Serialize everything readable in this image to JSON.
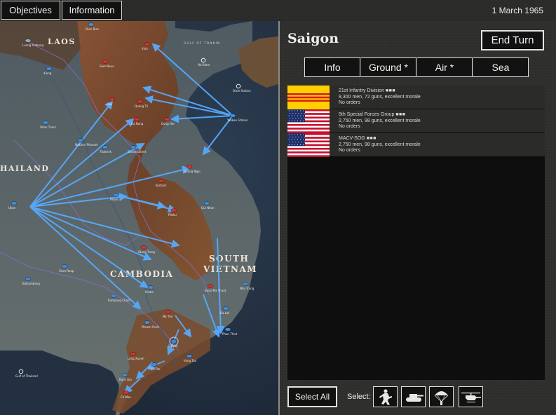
{
  "topbar": {
    "objectives_label": "Objectives",
    "information_label": "Information",
    "date": "1 March 1965"
  },
  "map": {
    "country_labels": {
      "laos": "LAOS",
      "thailand": "HAILAND",
      "cambodia": "CAMBODIA",
      "south_vietnam_1": "SOUTH",
      "south_vietnam_2": "VIETNAM"
    },
    "sea_label": "GULF OF TONKIN",
    "towns": [
      "Dien Bien",
      "Luang Prabang",
      "Xieng",
      "Sam Neua",
      "Vinh",
      "Dong Hoi",
      "Quang Tri",
      "Hue",
      "Da Nang",
      "Quang Ngai",
      "Kontum",
      "Pleiku",
      "Qui Nhon",
      "Buon Ma Thuot",
      "Nha Trang",
      "Da Lat",
      "Phan Thiet",
      "Vung Tau",
      "Saigon",
      "My Tho",
      "Can Tho",
      "Ca Mau",
      "Rach Gia",
      "Long Xuyen",
      "Phnom Penh",
      "Kampong Cham",
      "Kratie",
      "Stung Treng",
      "Siem Reap",
      "Battambang",
      "Pakse",
      "Savannakhet",
      "Thakhek",
      "Udon Thani",
      "Nakhon Phanom",
      "Ubon",
      "Hai Nam",
      "Yankee Station",
      "Dixie Station",
      "Gulf of Thailand"
    ]
  },
  "panel": {
    "location": "Saigon",
    "end_turn_label": "End Turn",
    "tabs": [
      "Info",
      "Ground *",
      "Air *",
      "Sea"
    ],
    "units": [
      {
        "name": "21st Infantry Division",
        "pips": "■■■",
        "strength": "8,300 men, 72 guns, excellent morale",
        "orders": "No orders",
        "flag": "south-vietnam-flag"
      },
      {
        "name": "5th Special Forces Group",
        "pips": "■■■",
        "strength": "2,750 men, 98 guns, excellent morale",
        "orders": "No orders",
        "flag": "us-flag"
      },
      {
        "name": "MACV-SOG",
        "pips": "■■■",
        "strength": "2,750 men, 98 guns, excellent morale",
        "orders": "No orders",
        "flag": "us-flag"
      }
    ],
    "select_all_label": "Select All",
    "select_label": "Select:",
    "filters": [
      "infantry-icon",
      "tank-icon",
      "paratrooper-icon",
      "helicopter-icon"
    ]
  },
  "colors": {
    "panel_bg": "#2e2f2c",
    "list_bg": "#0e0e0e",
    "row_bg": "#2b2b29",
    "arrow": "#4aa3ff",
    "terrain_mountain": "#7a4a2e",
    "sea": "#233243",
    "land": "#5a6468"
  }
}
